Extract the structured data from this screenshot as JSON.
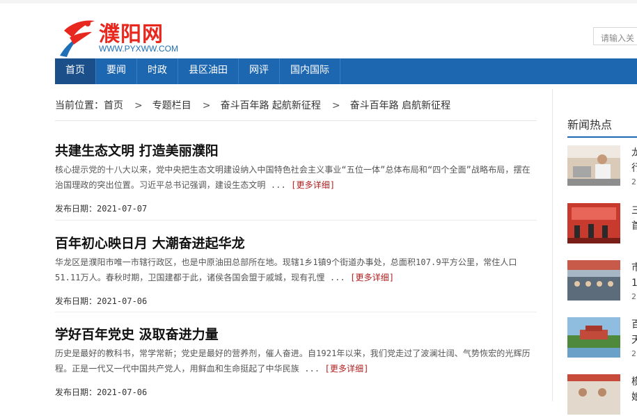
{
  "site": {
    "logo_cn": "濮阳网",
    "logo_en": "WWW.PYXWW.COM",
    "search_placeholder": "请输入关"
  },
  "nav": [
    {
      "label": "首页",
      "active": true
    },
    {
      "label": "要闻"
    },
    {
      "label": "时政"
    },
    {
      "label": "县区油田"
    },
    {
      "label": "网评"
    },
    {
      "label": "国内国际"
    }
  ],
  "breadcrumb": {
    "prefix": "当前位置：",
    "items": [
      "首页",
      "专题栏目",
      "奋斗百年路 起航新征程",
      "奋斗百年路 启航新征程"
    ],
    "separator": ">"
  },
  "articles": [
    {
      "title": "共建生态文明 打造美丽濮阳",
      "summary": "核心提示党的十八大以来，党中央把生态文明建设纳入中国特色社会主义事业“五位一体”总体布局和“四个全面”战略布局，摆在治国理政的突出位置。习近平总书记强调，建设生态文明 ...",
      "more": "[更多详细]",
      "date": "发布日期：2021-07-07"
    },
    {
      "title": "百年初心映日月 大潮奋进起华龙",
      "summary": "华龙区是濮阳市唯一市辖行政区，也是中原油田总部所在地。现辖1乡1镇9个街道办事处，总面积107.9平方公里，常住人口51.11万人。春秋时期，卫国建都于此，诸侯各国会盟于戚城，现有孔悝 ...",
      "more": "[更多详细]",
      "date": "发布日期：2021-07-06"
    },
    {
      "title": "学好百年党史 汲取奋进力量",
      "summary": "历史是最好的教科书，常学常新；党史是最好的营养剂，催人奋进。自1921年以来，我们党走过了波澜壮阔、气势恢宏的光辉历程。正是一代又一代中国共产党人，用鲜血和生命挺起了中华民族 ...",
      "more": "[更多详细]",
      "date": "发布日期：2021-07-06"
    }
  ],
  "sidebar": {
    "title": "新闻热点",
    "items": [
      {
        "text": "龙",
        "text2": "行",
        "sub": "2"
      },
      {
        "text": "三",
        "text2": "首",
        "sub": ""
      },
      {
        "text": "市",
        "text2": "1",
        "sub": "2"
      },
      {
        "text": "百",
        "text2": "天",
        "sub": "2"
      },
      {
        "text": "模",
        "text2": "娘",
        "sub": ""
      }
    ]
  },
  "colors": {
    "nav_bg": "#1d66b0",
    "nav_active": "#1a4f8a",
    "logo_red": "#e8281e",
    "logo_blue": "#1e6fb8",
    "more_link": "#b21e1e"
  }
}
